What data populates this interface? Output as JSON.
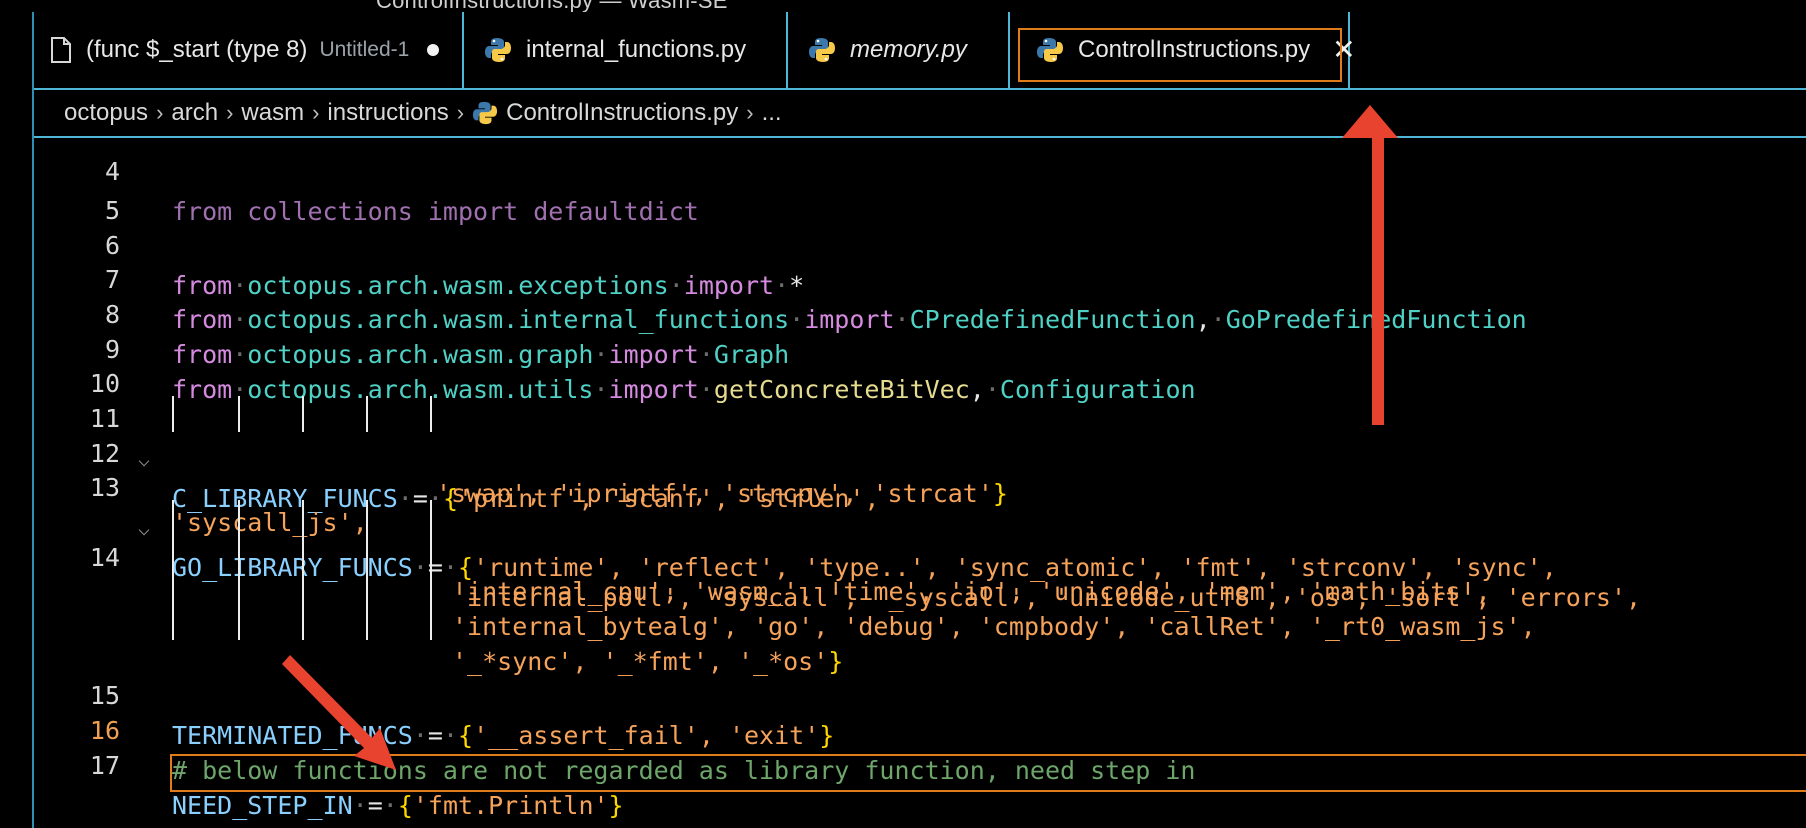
{
  "window": {
    "title": "ControlInstructions.py — Wasm-SE"
  },
  "tabs": [
    {
      "label": "(func $_start (type 8)",
      "sublabel": "Untitled-1",
      "icon": "file-icon",
      "dirty": true
    },
    {
      "label": "internal_functions.py",
      "icon": "python-icon"
    },
    {
      "label": "memory.py",
      "icon": "python-icon",
      "italic": true
    },
    {
      "label": "ControlInstructions.py",
      "icon": "python-icon",
      "active": true,
      "close": "✕"
    }
  ],
  "breadcrumb": {
    "items": [
      "octopus",
      "arch",
      "wasm",
      "instructions",
      "ControlInstructions.py",
      "..."
    ],
    "separator": "›"
  },
  "editor": {
    "partial_line_text": "from collections import defaultdict",
    "partial_line_number": "4",
    "current_line": "16",
    "lines": {
      "l5": "5",
      "l6": "6",
      "l7": "7",
      "l8": "8",
      "l9": "9",
      "l10": "10",
      "l11": "11",
      "l12": "12",
      "l13": "13",
      "l14": "14",
      "l15": "15",
      "l16": "16",
      "l17": "17"
    },
    "tokens": {
      "from": "from",
      "import": "import",
      "star": "*",
      "mod_exceptions": "octopus.arch.wasm.exceptions",
      "mod_internal": "octopus.arch.wasm.internal_functions",
      "mod_graph": "octopus.arch.wasm.graph",
      "mod_utils": "octopus.arch.wasm.utils",
      "cls_cpre": "CPredefinedFunction",
      "cls_gopre": "GoPredefinedFunction",
      "cls_graph": "Graph",
      "fn_getconcrete": "getConcreteBitVec",
      "cls_config": "Configuration",
      "c_lib": "C_LIBRARY_FUNCS",
      "go_lib": "GO_LIBRARY_FUNCS",
      "term": "TERMINATED_FUNCS",
      "need": "NEED_STEP_IN",
      "l11_strs": "'printf', 'scanf', 'strlen',",
      "l12_strs": "'swap', 'iprintf', 'strcpy', 'strcat'",
      "l13_strs": "'runtime', 'reflect', 'type..', 'sync_atomic', 'fmt', 'strconv', 'sync',",
      "l13b_strs": "'syscall_js',",
      "l14a": "'internal_poll', 'syscall', '_syscall', 'unicode_utf8', 'os', 'sort', 'errors',",
      "l14b": "'internal_cpu', 'wasm_', 'time', 'io', 'unicode', 'mem', 'math_bits',",
      "l14c": "'internal_bytealg', 'go', 'debug', 'cmpbody', 'callRet', '_rt0_wasm_js',",
      "l14d": "'_*sync', '_*fmt', '_*os'",
      "l15_strs": "'__assert_fail', 'exit'",
      "l16_comment": "# below functions are not regarded as library function, need step in",
      "l17_strs": "'fmt.Println'"
    }
  },
  "colors": {
    "accent_border": "#4fb6d6",
    "active_tab_frame": "#e07b1a",
    "annotation_arrow": "#e8432e"
  }
}
